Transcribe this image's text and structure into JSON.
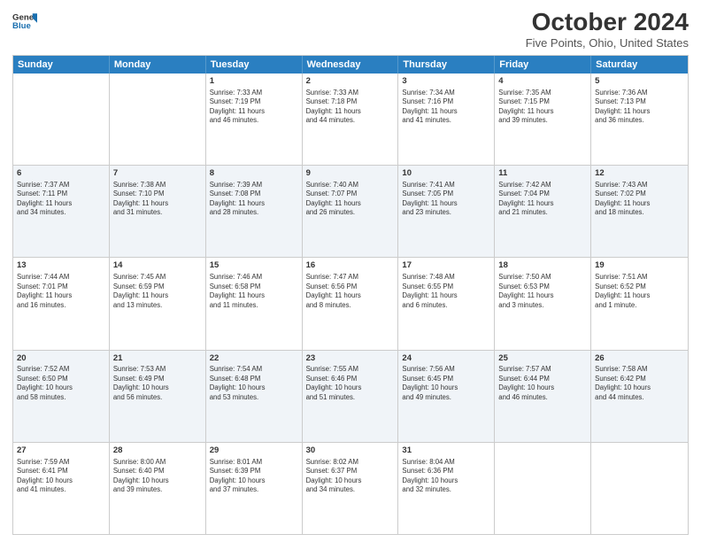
{
  "header": {
    "logo_line1": "General",
    "logo_line2": "Blue",
    "title": "October 2024",
    "subtitle": "Five Points, Ohio, United States"
  },
  "weekdays": [
    "Sunday",
    "Monday",
    "Tuesday",
    "Wednesday",
    "Thursday",
    "Friday",
    "Saturday"
  ],
  "rows": [
    [
      {
        "day": "",
        "lines": []
      },
      {
        "day": "",
        "lines": []
      },
      {
        "day": "1",
        "lines": [
          "Sunrise: 7:33 AM",
          "Sunset: 7:19 PM",
          "Daylight: 11 hours",
          "and 46 minutes."
        ]
      },
      {
        "day": "2",
        "lines": [
          "Sunrise: 7:33 AM",
          "Sunset: 7:18 PM",
          "Daylight: 11 hours",
          "and 44 minutes."
        ]
      },
      {
        "day": "3",
        "lines": [
          "Sunrise: 7:34 AM",
          "Sunset: 7:16 PM",
          "Daylight: 11 hours",
          "and 41 minutes."
        ]
      },
      {
        "day": "4",
        "lines": [
          "Sunrise: 7:35 AM",
          "Sunset: 7:15 PM",
          "Daylight: 11 hours",
          "and 39 minutes."
        ]
      },
      {
        "day": "5",
        "lines": [
          "Sunrise: 7:36 AM",
          "Sunset: 7:13 PM",
          "Daylight: 11 hours",
          "and 36 minutes."
        ]
      }
    ],
    [
      {
        "day": "6",
        "lines": [
          "Sunrise: 7:37 AM",
          "Sunset: 7:11 PM",
          "Daylight: 11 hours",
          "and 34 minutes."
        ]
      },
      {
        "day": "7",
        "lines": [
          "Sunrise: 7:38 AM",
          "Sunset: 7:10 PM",
          "Daylight: 11 hours",
          "and 31 minutes."
        ]
      },
      {
        "day": "8",
        "lines": [
          "Sunrise: 7:39 AM",
          "Sunset: 7:08 PM",
          "Daylight: 11 hours",
          "and 28 minutes."
        ]
      },
      {
        "day": "9",
        "lines": [
          "Sunrise: 7:40 AM",
          "Sunset: 7:07 PM",
          "Daylight: 11 hours",
          "and 26 minutes."
        ]
      },
      {
        "day": "10",
        "lines": [
          "Sunrise: 7:41 AM",
          "Sunset: 7:05 PM",
          "Daylight: 11 hours",
          "and 23 minutes."
        ]
      },
      {
        "day": "11",
        "lines": [
          "Sunrise: 7:42 AM",
          "Sunset: 7:04 PM",
          "Daylight: 11 hours",
          "and 21 minutes."
        ]
      },
      {
        "day": "12",
        "lines": [
          "Sunrise: 7:43 AM",
          "Sunset: 7:02 PM",
          "Daylight: 11 hours",
          "and 18 minutes."
        ]
      }
    ],
    [
      {
        "day": "13",
        "lines": [
          "Sunrise: 7:44 AM",
          "Sunset: 7:01 PM",
          "Daylight: 11 hours",
          "and 16 minutes."
        ]
      },
      {
        "day": "14",
        "lines": [
          "Sunrise: 7:45 AM",
          "Sunset: 6:59 PM",
          "Daylight: 11 hours",
          "and 13 minutes."
        ]
      },
      {
        "day": "15",
        "lines": [
          "Sunrise: 7:46 AM",
          "Sunset: 6:58 PM",
          "Daylight: 11 hours",
          "and 11 minutes."
        ]
      },
      {
        "day": "16",
        "lines": [
          "Sunrise: 7:47 AM",
          "Sunset: 6:56 PM",
          "Daylight: 11 hours",
          "and 8 minutes."
        ]
      },
      {
        "day": "17",
        "lines": [
          "Sunrise: 7:48 AM",
          "Sunset: 6:55 PM",
          "Daylight: 11 hours",
          "and 6 minutes."
        ]
      },
      {
        "day": "18",
        "lines": [
          "Sunrise: 7:50 AM",
          "Sunset: 6:53 PM",
          "Daylight: 11 hours",
          "and 3 minutes."
        ]
      },
      {
        "day": "19",
        "lines": [
          "Sunrise: 7:51 AM",
          "Sunset: 6:52 PM",
          "Daylight: 11 hours",
          "and 1 minute."
        ]
      }
    ],
    [
      {
        "day": "20",
        "lines": [
          "Sunrise: 7:52 AM",
          "Sunset: 6:50 PM",
          "Daylight: 10 hours",
          "and 58 minutes."
        ]
      },
      {
        "day": "21",
        "lines": [
          "Sunrise: 7:53 AM",
          "Sunset: 6:49 PM",
          "Daylight: 10 hours",
          "and 56 minutes."
        ]
      },
      {
        "day": "22",
        "lines": [
          "Sunrise: 7:54 AM",
          "Sunset: 6:48 PM",
          "Daylight: 10 hours",
          "and 53 minutes."
        ]
      },
      {
        "day": "23",
        "lines": [
          "Sunrise: 7:55 AM",
          "Sunset: 6:46 PM",
          "Daylight: 10 hours",
          "and 51 minutes."
        ]
      },
      {
        "day": "24",
        "lines": [
          "Sunrise: 7:56 AM",
          "Sunset: 6:45 PM",
          "Daylight: 10 hours",
          "and 49 minutes."
        ]
      },
      {
        "day": "25",
        "lines": [
          "Sunrise: 7:57 AM",
          "Sunset: 6:44 PM",
          "Daylight: 10 hours",
          "and 46 minutes."
        ]
      },
      {
        "day": "26",
        "lines": [
          "Sunrise: 7:58 AM",
          "Sunset: 6:42 PM",
          "Daylight: 10 hours",
          "and 44 minutes."
        ]
      }
    ],
    [
      {
        "day": "27",
        "lines": [
          "Sunrise: 7:59 AM",
          "Sunset: 6:41 PM",
          "Daylight: 10 hours",
          "and 41 minutes."
        ]
      },
      {
        "day": "28",
        "lines": [
          "Sunrise: 8:00 AM",
          "Sunset: 6:40 PM",
          "Daylight: 10 hours",
          "and 39 minutes."
        ]
      },
      {
        "day": "29",
        "lines": [
          "Sunrise: 8:01 AM",
          "Sunset: 6:39 PM",
          "Daylight: 10 hours",
          "and 37 minutes."
        ]
      },
      {
        "day": "30",
        "lines": [
          "Sunrise: 8:02 AM",
          "Sunset: 6:37 PM",
          "Daylight: 10 hours",
          "and 34 minutes."
        ]
      },
      {
        "day": "31",
        "lines": [
          "Sunrise: 8:04 AM",
          "Sunset: 6:36 PM",
          "Daylight: 10 hours",
          "and 32 minutes."
        ]
      },
      {
        "day": "",
        "lines": []
      },
      {
        "day": "",
        "lines": []
      }
    ]
  ]
}
